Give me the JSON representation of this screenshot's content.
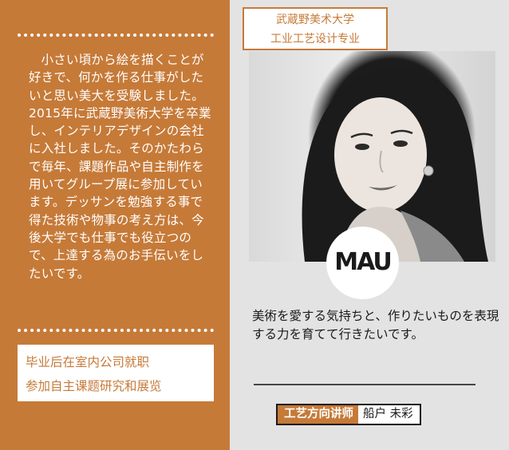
{
  "school": {
    "line1": "武蔵野美术大学",
    "line2": "工业工艺设计专业"
  },
  "bio": {
    "text": "小さい頃から絵を描くことが好きで、何かを作る仕事がしたいと思い美大を受験しました。2015年に武蔵野美術大学を卒業し、インテリアデザインの会社に入社しました。そのかたわらで毎年、課題作品や自主制作を用いてグループ展に参加しています。デッサンを勉強する事で得た技術や物事の考え方は、今後大学でも仕事でも役立つので、上達する為のお手伝いをしたいです。"
  },
  "career": {
    "line1": "毕业后在室内公司就职",
    "line2": "参加自主课题研究和展览"
  },
  "logo": {
    "text": "MAU"
  },
  "quote": {
    "text": "美術を愛する気持ちと、作りたいものを表現する力を育てて行きたいです。"
  },
  "teacher": {
    "role": "工艺方向讲师",
    "name": "船户 未彩"
  },
  "colors": {
    "accent": "#c67a38",
    "panel_grey": "#e3e3e3"
  }
}
